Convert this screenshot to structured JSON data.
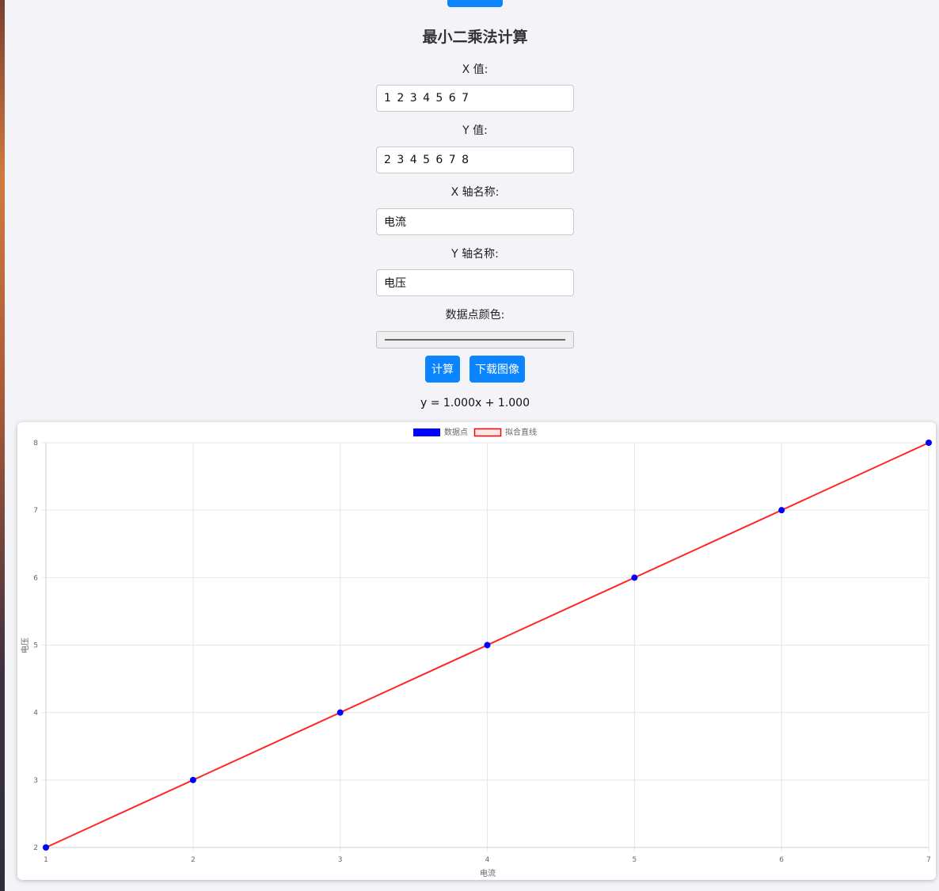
{
  "form": {
    "title": "最小二乘法计算",
    "x_label": "X 值:",
    "x_value": "1 2 3 4 5 6 7",
    "y_label": "Y 值:",
    "y_value": "2 3 4 5 6 7 8",
    "x_axis_label": "X 轴名称:",
    "x_axis_value": "电流",
    "y_axis_label": "Y 轴名称:",
    "y_axis_value": "电压",
    "color_label": "数据点颜色:",
    "compute_button": "计算",
    "download_button": "下载图像"
  },
  "result": {
    "equation": "y = 1.000x + 1.000"
  },
  "colors": {
    "accent": "#0a84ff",
    "points": "#0000ff",
    "fit_line": "#ff0000"
  },
  "chart_data": {
    "type": "scatter",
    "xlabel": "电流",
    "ylabel": "电压",
    "xlim": [
      1,
      7
    ],
    "ylim": [
      2,
      8
    ],
    "x_ticks": [
      1,
      2,
      3,
      4,
      5,
      6,
      7
    ],
    "y_ticks": [
      2,
      3,
      4,
      5,
      6,
      7,
      8
    ],
    "grid": true,
    "legend_position": "top-center",
    "series": [
      {
        "name": "数据点",
        "type": "scatter",
        "x": [
          1,
          2,
          3,
          4,
          5,
          6,
          7
        ],
        "y": [
          2,
          3,
          4,
          5,
          6,
          7,
          8
        ]
      },
      {
        "name": "拟合直线",
        "type": "line",
        "x": [
          1,
          7
        ],
        "y": [
          2,
          8
        ]
      }
    ]
  }
}
